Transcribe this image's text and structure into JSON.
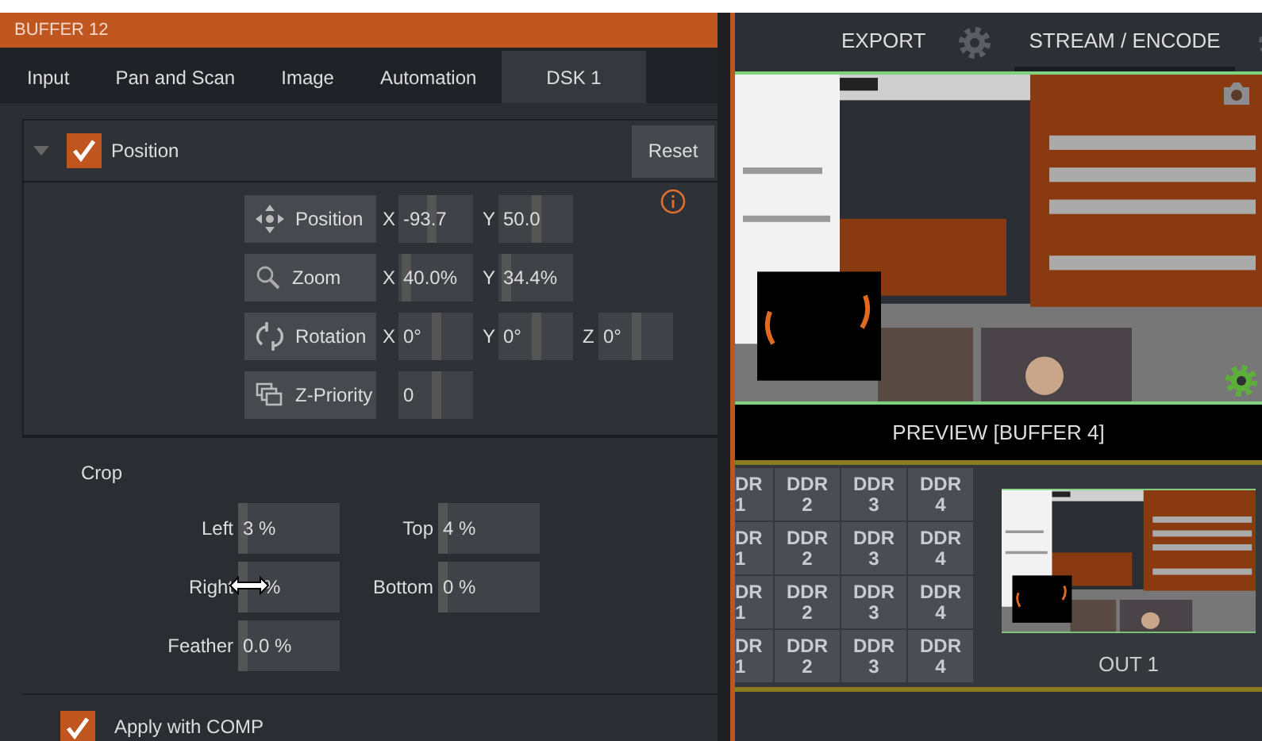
{
  "buffer": {
    "title": "BUFFER 12",
    "tabs": [
      {
        "label": "Input",
        "selected": false
      },
      {
        "label": "Pan and Scan",
        "selected": false
      },
      {
        "label": "Image",
        "selected": false
      },
      {
        "label": "Automation",
        "selected": false
      },
      {
        "label": "DSK 1",
        "selected": true
      }
    ],
    "position_section": {
      "title": "Position",
      "checked": true,
      "expanded": true,
      "reset": "Reset",
      "rows": [
        {
          "kind": "position",
          "label": "Position",
          "fields": [
            {
              "axis": "X",
              "value": "-93.7",
              "level": 0.45
            },
            {
              "axis": "Y",
              "value": "50.0",
              "level": 0.5
            }
          ]
        },
        {
          "kind": "zoom",
          "label": "Zoom",
          "fields": [
            {
              "axis": "X",
              "value": "40.0%",
              "level": 0.05
            },
            {
              "axis": "Y",
              "value": "34.4%",
              "level": 0.05
            }
          ]
        },
        {
          "kind": "rotation",
          "label": "Rotation",
          "fields": [
            {
              "axis": "X",
              "value": "0°",
              "level": 0.5
            },
            {
              "axis": "Y",
              "value": "0°",
              "level": 0.5
            },
            {
              "axis": "Z",
              "value": "0°",
              "level": 0.5
            }
          ]
        },
        {
          "kind": "zpriority",
          "label": "Z-Priority",
          "fields": [
            {
              "value": "0",
              "level": 0.5
            }
          ]
        }
      ]
    },
    "crop": {
      "title": "Crop",
      "rows": [
        [
          {
            "label": "Left",
            "value": "3 %",
            "level": 0,
            "cursor": false
          },
          {
            "label": "Top",
            "value": "4 %",
            "level": 0,
            "cursor": false
          }
        ],
        [
          {
            "label": "Right",
            "value": "%",
            "level": 0,
            "cursor": true
          },
          {
            "label": "Bottom",
            "value": "0 %",
            "level": 0,
            "cursor": false
          }
        ],
        [
          {
            "label": "Feather",
            "value": "0.0 %",
            "level": 0,
            "cursor": false
          }
        ]
      ]
    },
    "comp_section": {
      "title": "Apply with COMP",
      "checked": true
    }
  },
  "output": {
    "tabs": [
      {
        "label": "EXPORT",
        "selected": false
      },
      {
        "label": "STREAM / ENCODE",
        "selected": true
      }
    ],
    "preview_label": "PREVIEW [BUFFER 4]",
    "ddr_grid": [
      [
        "DR 1",
        "DDR 2",
        "DDR 3",
        "DDR 4"
      ],
      [
        "DR 1",
        "DDR 2",
        "DDR 3",
        "DDR 4"
      ],
      [
        "DR 1",
        "DDR 2",
        "DDR 3",
        "DDR 4"
      ],
      [
        "DR 1",
        "DDR 2",
        "DDR 3",
        "DDR 4"
      ]
    ],
    "out_label": "OUT 1"
  }
}
